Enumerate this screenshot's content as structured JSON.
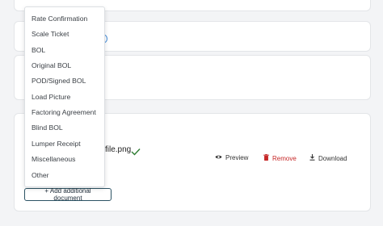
{
  "dropdown": {
    "items": [
      "Rate Confirmation",
      "Scale Ticket",
      "BOL",
      "Original BOL",
      "POD/Signed BOL",
      "Load Picture",
      "Factoring Agreement",
      "Blind BOL",
      "Lumper Receipt",
      "Miscellaneous",
      "Other"
    ]
  },
  "file": {
    "name_fragment": "file.png"
  },
  "actions": {
    "preview": "Preview",
    "remove": "Remove",
    "download": "Download"
  },
  "add_document": "+ Add additional document",
  "icons": {
    "preview": "eye-icon",
    "remove": "trash-icon",
    "download": "download-icon",
    "status": "check-icon"
  },
  "colors": {
    "remove": "#c62828",
    "check": "#2e7d32",
    "button_border": "#2c5364",
    "accent_circle": "#4a90d9"
  }
}
